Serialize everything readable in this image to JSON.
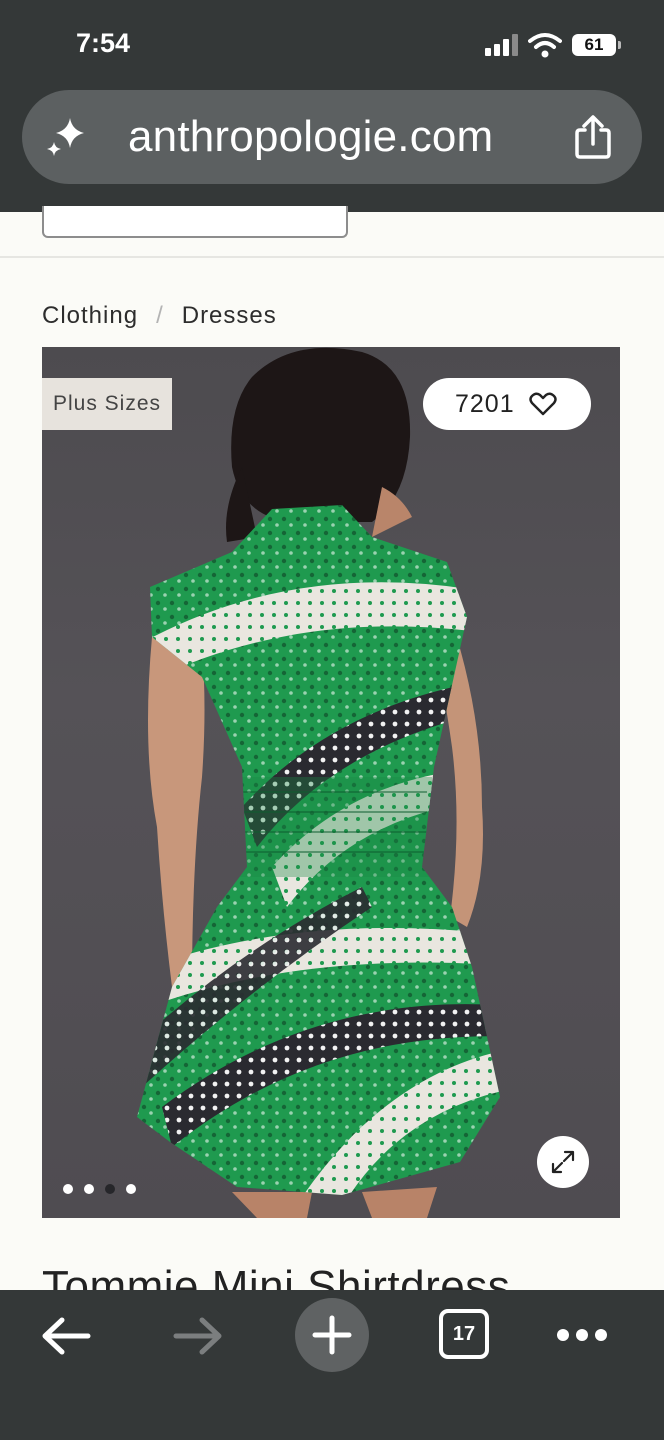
{
  "status_bar": {
    "time": "7:54",
    "battery": "61"
  },
  "browser": {
    "url": "anthropologie.com",
    "open_tabs": "17"
  },
  "breadcrumb": {
    "items": [
      "Clothing",
      "Dresses"
    ],
    "separator": "/"
  },
  "product": {
    "badge": "Plus Sizes",
    "favorites_count": "7201",
    "title": "Tommie Mini Shirtdress",
    "image_count": 4,
    "active_image_index": 2
  },
  "icons": {
    "url_left": "sparkle-icon",
    "url_right": "share-icon",
    "favorite": "heart-icon",
    "expand": "expand-icon",
    "back": "arrow-left-icon",
    "forward": "arrow-right-icon",
    "new_tab": "plus-icon",
    "more": "more-dots-icon"
  },
  "colors": {
    "chrome": "#343838",
    "url_bar": "#5c6061",
    "page_bg": "#fbfbf7",
    "dress_green": "#1f9a4f"
  }
}
